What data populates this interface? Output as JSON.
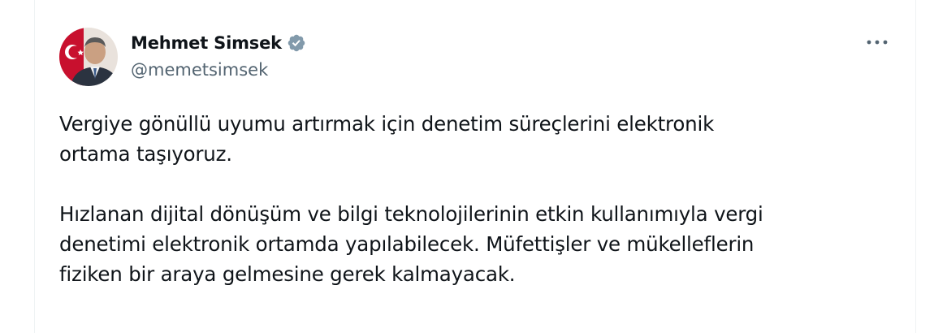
{
  "tweet": {
    "author": {
      "display_name": "Mehmet Simsek",
      "handle": "@memetsimsek",
      "verified": true,
      "verified_color": "#829aab"
    },
    "more_icon": "more-horizontal-icon",
    "paragraphs": [
      "Vergiye gönüllü uyumu artırmak için denetim süreçlerini elektronik\nortama taşıyoruz.",
      "Hızlanan dijital dönüşüm ve bilgi teknolojilerinin etkin kullanımıyla vergi\ndenetimi elektronik ortamda yapılabilecek. Müfettişler ve mükelleflerin\nfiziken bir araya gelmesine gerek kalmayacak."
    ]
  },
  "colors": {
    "text_primary": "#0f1419",
    "text_secondary": "#536471",
    "border": "#eff3f4"
  }
}
